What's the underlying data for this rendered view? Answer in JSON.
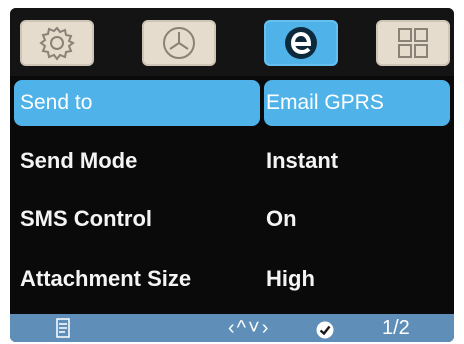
{
  "tabs": [
    {
      "icon": "gear-icon",
      "active": false
    },
    {
      "icon": "clock-icon",
      "active": false
    },
    {
      "icon": "email-e-icon",
      "active": true
    },
    {
      "icon": "grid-icon",
      "active": false
    }
  ],
  "menu": {
    "rows": [
      {
        "label": "Send to",
        "value": "Email GPRS",
        "selected": true
      },
      {
        "label": "Send Mode",
        "value": "Instant",
        "selected": false
      },
      {
        "label": "SMS Control",
        "value": "On",
        "selected": false
      },
      {
        "label": "Attachment Size",
        "value": "High",
        "selected": false
      }
    ]
  },
  "footer": {
    "left_icon": "document-icon",
    "nav_hint": "‹^˅›",
    "confirm_icon": "checkmark-icon",
    "page": "1/2"
  },
  "colors": {
    "accent": "#4fb3ea",
    "background": "#0a0a0a",
    "footer": "#5f8fb8",
    "tab_inactive": "#e6dccd"
  }
}
